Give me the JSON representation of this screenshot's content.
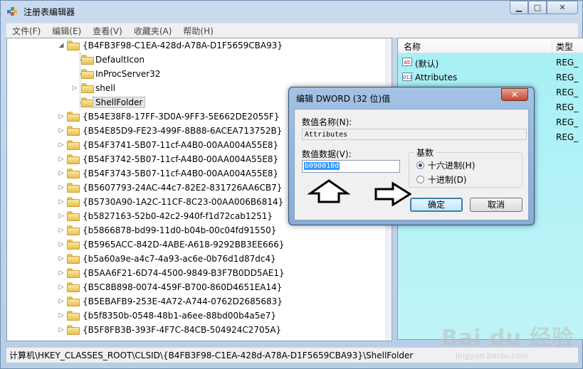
{
  "window": {
    "title": "注册表编辑器",
    "min_symbol": "▁",
    "max_symbol": "□",
    "close_symbol": "✕"
  },
  "menu": [
    "文件(F)",
    "编辑(E)",
    "查看(V)",
    "收藏夹(A)",
    "帮助(H)"
  ],
  "tree": {
    "parent_key": "{B4FB3F98-C1EA-428d-A78A-D1F5659CBA93}",
    "children": [
      "DefaultIcon",
      "InProcServer32",
      "shell",
      "ShellFolder"
    ],
    "selected": "ShellFolder",
    "siblings": [
      "{B54E38F8-17FF-3D0A-9FF3-5E662DE2055F}",
      "{B54E85D9-FE23-499F-8B88-6ACEA713752B}",
      "{B54F3741-5B07-11cf-A4B0-00AA004A55E8}",
      "{B54F3742-5B07-11cf-A4B0-00AA004A55E8}",
      "{B54F3743-5B07-11cf-A4B0-00AA004A55E8}",
      "{B5607793-24AC-44c7-82E2-831726AA6CB7}",
      "{B5730A90-1A2C-11CF-8C23-00AA006B6814}",
      "{b5827163-52b0-42c2-940f-f1d72cab1251}",
      "{b5866878-bd99-11d0-b04b-00c04fd91550}",
      "{B5965ACC-842D-4ABE-A618-9292BB3EE666}",
      "{b5a60a9e-a4c7-4a93-ac6e-0b76d1d87dc4}",
      "{B5AA6F21-6D74-4500-9849-B3F7B0DD5AE1}",
      "{B5C8B898-0074-459F-B700-860D4651EA14}",
      "{B5EBAFB9-253E-4A72-A744-0762D2685683}",
      "{b5f8350b-0548-48b1-a6ee-88bd00b4a5e7}",
      "{B5F8FB3B-393F-4F7C-84CB-504924C2705A}"
    ]
  },
  "values_pane": {
    "col_name": "名称",
    "col_type": "类型",
    "rows": [
      {
        "icon": "ab",
        "name": "(默认)",
        "type": "REG_"
      },
      {
        "icon": "011",
        "name": "Attributes",
        "type": "REG_"
      },
      {
        "icon": "",
        "name": "",
        "type": "REG_"
      },
      {
        "icon": "",
        "name": "",
        "type": "REG_"
      },
      {
        "icon": "",
        "name": "",
        "type": "REG_"
      },
      {
        "icon": "",
        "name": "",
        "type": "REG_"
      }
    ]
  },
  "status": "计算机\\HKEY_CLASSES_ROOT\\CLSID\\{B4FB3F98-C1EA-428d-A78A-D1F5659CBA93}\\ShellFolder",
  "dialog": {
    "title": "编辑 DWORD (32 位)值",
    "close_symbol": "✕",
    "name_label": "数值名称(N):",
    "name_value": "Attributes",
    "data_label": "数值数据(V):",
    "data_value": "b090010d",
    "base_label": "基数",
    "hex_label": "十六进制(H)",
    "dec_label": "十进制(D)",
    "base_selected": "hex",
    "ok_label": "确定",
    "cancel_label": "取消"
  },
  "watermark": {
    "brand": "Bai du 经验",
    "url": "jingyan.baidu.com"
  },
  "icons": {
    "folder": "folder-icon",
    "app": "registry-editor-icon",
    "arrow_up": "up-arrow-icon",
    "arrow_right": "right-arrow-icon"
  }
}
